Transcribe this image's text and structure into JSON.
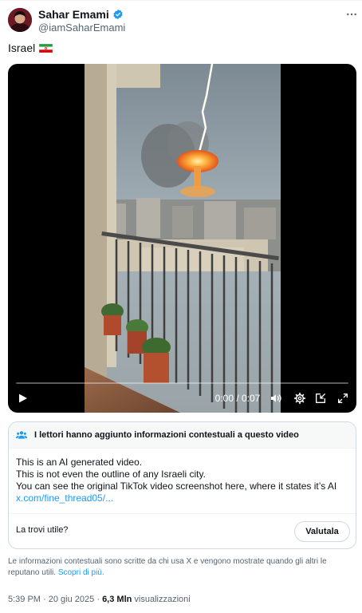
{
  "author": {
    "display_name": "Sahar Emami",
    "handle": "@iamSaharEmami",
    "verified": true
  },
  "post": {
    "text": "Israel",
    "flag_icon": "iran-flag-icon"
  },
  "video": {
    "timecode": "0:00 / 0:07",
    "progress": 0
  },
  "community_note": {
    "title": "I lettori hanno aggiunto informazioni contestuali a questo video",
    "lines": [
      "This is an AI generated video.",
      "This is not even the outline of any Israeli city.",
      "You can see the original TikTok video screenshot here, where it states it’s AI"
    ],
    "link": "x.com/fine_thread05/...",
    "question": "La trovi utile?",
    "rate_label": "Valutala"
  },
  "disclaimer": {
    "text": "Le informazioni contestuali sono scritte da chi usa X e vengono mostrate quando gli altri le reputano utili.",
    "link": "Scopri di più."
  },
  "meta": {
    "time": "5:39 PM",
    "date": "20 giu 2025",
    "views_count": "6,3 Mln",
    "views_label": "visualizzazioni"
  },
  "colors": {
    "accent": "#1d9bf0",
    "text": "#0f1419",
    "secondary": "#536471"
  }
}
